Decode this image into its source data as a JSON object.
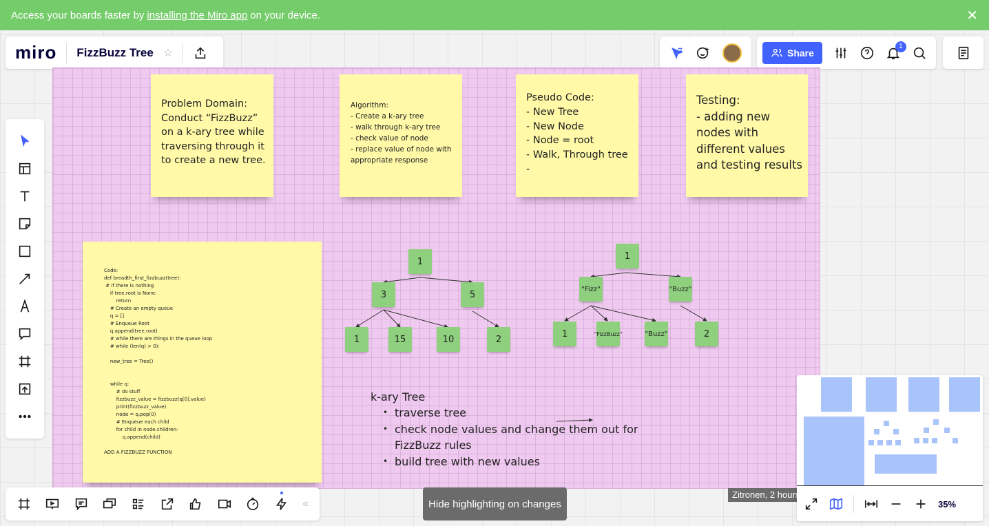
{
  "banner": {
    "text_before": "Access your boards faster by",
    "link": "installing the Miro app",
    "text_after": "on your device."
  },
  "header": {
    "logo": "miro",
    "board_title": "FizzBuzz Tree",
    "share_label": "Share",
    "notification_count": "1"
  },
  "stickies": {
    "problem": [
      "Problem Domain:",
      "Conduct “FizzBuzz”",
      "on a k-ary tree while",
      "traversing through it",
      "to create a new tree."
    ],
    "algorithm": [
      "Algorithm:",
      "- Create a k-ary tree",
      "- walk through k-ary tree",
      "- check value of node",
      "- replace value of node with",
      "appropriate response"
    ],
    "pseudo": [
      "Pseudo Code:",
      "- New Tree",
      "- New Node",
      "- Node = root",
      "- Walk, Through tree",
      "-"
    ],
    "testing": [
      "Testing:",
      "- adding new",
      "nodes with",
      "different values",
      "and testing results"
    ],
    "code": [
      "Code:",
      "def breadth_first_fizzbuzz(tree):",
      " # if there is nothing",
      "    if tree.root is None:",
      "        return",
      "    # Create an empty queue",
      "    q = []",
      "    # Enqueue Root",
      "    q.append(tree.root)",
      "    # while there are things in the queue loop",
      "    # while (len(q) > 0):",
      "",
      "    new_tree = Tree()",
      "",
      "",
      "    while q:",
      "        # do stuff",
      "        fizzbuzz_value = fizzbuzz(q[0].value)",
      "        print(fizzbuzz_value)",
      "        node = q.pop(0)",
      "        # Enqueue each child",
      "        for child in node.children:",
      "            q.append(child)",
      "",
      "ADD A FIZZBUZZ FUNCTION"
    ]
  },
  "tree_original": {
    "root": "1",
    "level1": [
      "3",
      "5"
    ],
    "level2": [
      "1",
      "15",
      "10",
      "2"
    ]
  },
  "tree_fizzbuzz": {
    "root": "1",
    "level1": [
      "\"Fizz\"",
      "\"Buzz\""
    ],
    "level2": [
      "1",
      "\"FizzBuzz\"",
      "\"Buzz\"",
      "2"
    ]
  },
  "kary_text": {
    "title": "k-ary Tree",
    "bullets": [
      "traverse tree",
      "check node values and change them out for",
      "build tree with new values"
    ],
    "continuation": "FizzBuzz rules"
  },
  "tooltip": "Hide highlighting on changes",
  "cursor_tag": "Zitronen, 2 hours",
  "zoom": "35%"
}
